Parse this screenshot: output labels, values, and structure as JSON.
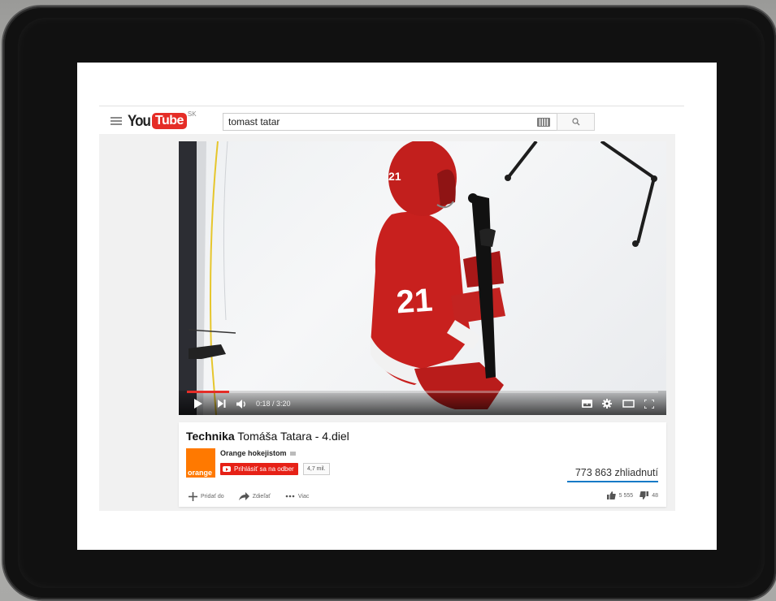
{
  "masthead": {
    "logo_you": "You",
    "logo_tube": "Tube",
    "logo_country": "SK",
    "search_value": "tomast tatar"
  },
  "player": {
    "time_current": "0:18",
    "time_total": "3:20",
    "time_display": "0:18 / 3:20",
    "progress_fraction": 0.09,
    "progress_color": "#e52d27",
    "jersey_number": "21"
  },
  "video": {
    "title_bold": "Technika",
    "title_rest": " Tomáša Tatara - 4.diel",
    "views": "773 863 zhliadnutí"
  },
  "channel": {
    "name": "Orange hokejistom",
    "thumb_text": "orange",
    "thumb_color": "#ff7900",
    "subscribe_label": "Prihlásiť sa na odber",
    "subscriber_count": "4,7 mil."
  },
  "actions": {
    "add_label": "Pridať do",
    "share_label": "Zdieľať",
    "more_label": "Viac",
    "likes": "5 555",
    "dislikes": "48"
  },
  "icons": {
    "guide": "hamburger-menu-icon",
    "search": "search-icon",
    "keyboard": "keyboard-icon",
    "play": "play-icon",
    "next": "next-icon",
    "volume": "volume-icon",
    "subtitles": "subtitles-icon",
    "settings": "gear-icon",
    "theater": "theater-mode-icon",
    "fullscreen": "fullscreen-icon"
  }
}
